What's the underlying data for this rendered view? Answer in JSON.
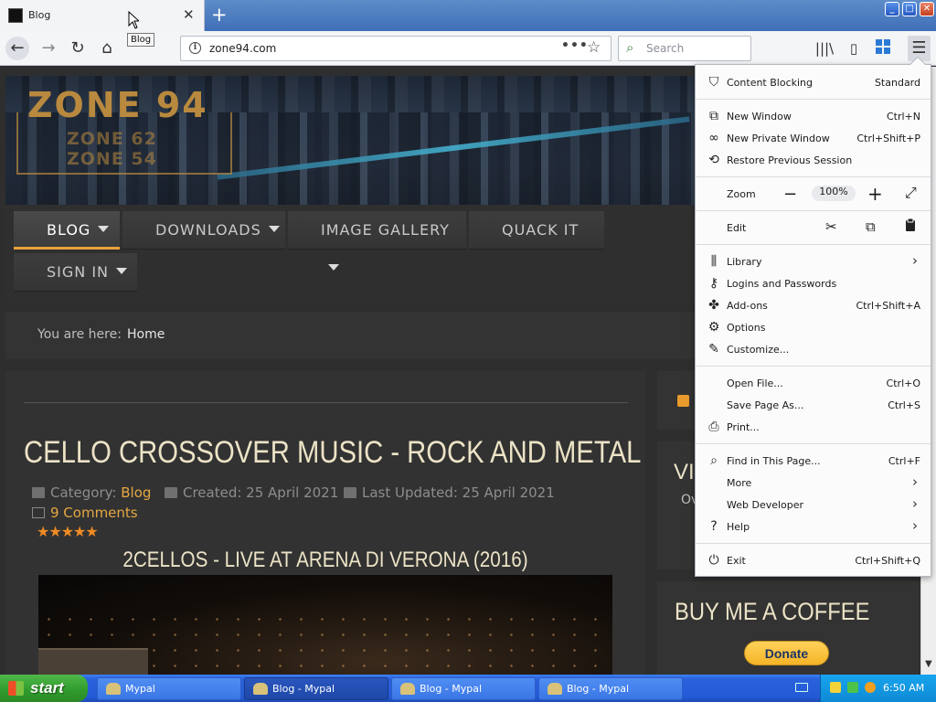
{
  "window": {
    "tab_title": "Blog",
    "tooltip": "Blog",
    "new_tab": "+",
    "tab_close": "✕",
    "win_min": "_",
    "win_max": "□",
    "win_close": "✕"
  },
  "toolbar": {
    "back": "←",
    "forward": "→",
    "reload": "↻",
    "home": "⌂",
    "url": "zone94.com",
    "page_actions": "•••",
    "bookmark_star": "☆",
    "search_placeholder": "Search",
    "library_icon": "|||\\",
    "sidebar_icon": "▯",
    "menu_icon": "☰"
  },
  "site": {
    "logo_main": "ZONE 94",
    "logo_sub1": "ZONE 62",
    "logo_sub2": "ZONE 54",
    "nav": [
      {
        "label": "BLOG"
      },
      {
        "label": "DOWNLOADS"
      },
      {
        "label": "IMAGE GALLERY"
      },
      {
        "label": "QUACK IT"
      },
      {
        "label": "SIGN IN"
      }
    ],
    "breadcrumb_label": "You are here:",
    "breadcrumb_home": "Home"
  },
  "article": {
    "title": "CELLO CROSSOVER MUSIC - ROCK AND METAL",
    "category_label": "Category:",
    "category": "Blog",
    "created": "Created: 25 April 2021",
    "updated": "Last Updated: 25 April 2021",
    "comments": "9 Comments",
    "stars": "★★★★★",
    "rating": 5,
    "video_title": "2CELLOS - LIVE AT ARENA DI VERONA (2016)"
  },
  "sidebar": {
    "visitors_title": "VIS",
    "visitors_sub": "Ov",
    "coffee_title": "BUY ME A COFFEE",
    "donate": "Donate"
  },
  "app_menu": {
    "content_blocking": {
      "label": "Content Blocking",
      "value": "Standard"
    },
    "new_window": {
      "label": "New Window",
      "shortcut": "Ctrl+N"
    },
    "new_private_window": {
      "label": "New Private Window",
      "shortcut": "Ctrl+Shift+P"
    },
    "restore_session": {
      "label": "Restore Previous Session"
    },
    "zoom": {
      "label": "Zoom",
      "minus": "−",
      "value": "100%",
      "plus": "+",
      "fullscreen": "⤢"
    },
    "edit": {
      "label": "Edit",
      "cut": "✂",
      "copy": "⧉",
      "paste": "📋"
    },
    "library": {
      "label": "Library"
    },
    "logins": {
      "label": "Logins and Passwords"
    },
    "addons": {
      "label": "Add-ons",
      "shortcut": "Ctrl+Shift+A"
    },
    "options": {
      "label": "Options"
    },
    "customize": {
      "label": "Customize..."
    },
    "open_file": {
      "label": "Open File...",
      "shortcut": "Ctrl+O"
    },
    "save_page": {
      "label": "Save Page As...",
      "shortcut": "Ctrl+S"
    },
    "print": {
      "label": "Print..."
    },
    "find": {
      "label": "Find in This Page...",
      "shortcut": "Ctrl+F"
    },
    "more": {
      "label": "More"
    },
    "web_developer": {
      "label": "Web Developer"
    },
    "help": {
      "label": "Help"
    },
    "exit": {
      "label": "Exit",
      "shortcut": "Ctrl+Shift+Q"
    },
    "submenu_arrow": "›"
  },
  "taskbar": {
    "start": "start",
    "tasks": [
      {
        "label": "Mypal"
      },
      {
        "label": "Blog - Mypal"
      },
      {
        "label": "Blog - Mypal"
      },
      {
        "label": "Blog - Mypal"
      }
    ],
    "clock": "6:50 AM"
  },
  "colors": {
    "accent_orange": "#e4a842",
    "title_cream": "#ece3c6",
    "taskbar_blue": "#245ad6",
    "start_green": "#2f9a2c"
  }
}
